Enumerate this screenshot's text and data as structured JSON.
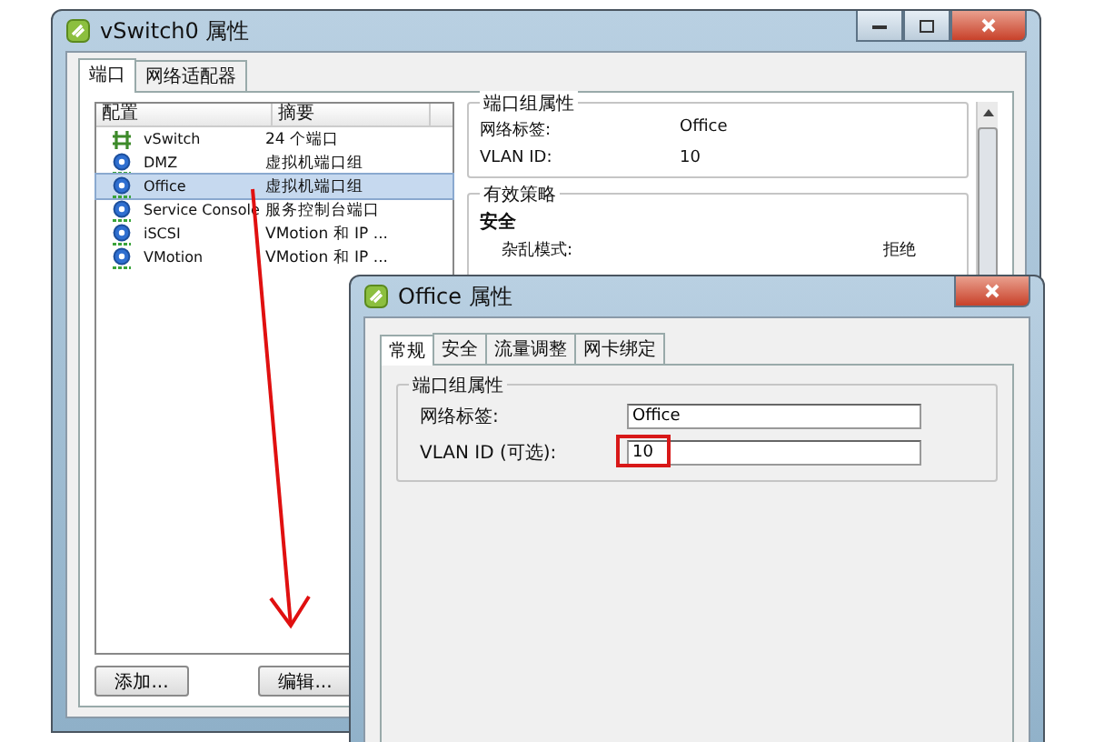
{
  "main_window": {
    "title": "vSwitch0 属性",
    "tabs": [
      {
        "label": "端口",
        "selected": true
      },
      {
        "label": "网络适配器",
        "selected": false
      }
    ],
    "list": {
      "columns": [
        "配置",
        "摘要"
      ],
      "rows": [
        {
          "kind": "switch",
          "name": "vSwitch",
          "summary": "24 个端口",
          "selected": false
        },
        {
          "kind": "port-group",
          "name": "DMZ",
          "summary": "虚拟机端口组",
          "selected": false
        },
        {
          "kind": "port-group",
          "name": "Office",
          "summary": "虚拟机端口组",
          "selected": true
        },
        {
          "kind": "port-group",
          "name": "Service Console",
          "summary": "服务控制台端口",
          "selected": false
        },
        {
          "kind": "port-group",
          "name": "iSCSI",
          "summary": "VMotion 和 IP ...",
          "selected": false
        },
        {
          "kind": "port-group",
          "name": "VMotion",
          "summary": "VMotion 和 IP ...",
          "selected": false
        }
      ]
    },
    "buttons": [
      "添加...",
      "编辑..."
    ],
    "port_group_properties": {
      "title": "端口组属性",
      "rows": [
        {
          "label": "网络标签:",
          "value": "Office"
        },
        {
          "label": "VLAN ID:",
          "value": "10"
        }
      ]
    },
    "effective_policy": {
      "title": "有效策略",
      "section": "安全",
      "rows": [
        {
          "label": "杂乱模式:",
          "value": "拒绝"
        }
      ]
    }
  },
  "dialog": {
    "title": "Office 属性",
    "tabs": [
      {
        "label": "常规",
        "selected": true
      },
      {
        "label": "安全",
        "selected": false
      },
      {
        "label": "流量调整",
        "selected": false
      },
      {
        "label": "网卡绑定",
        "selected": false
      }
    ],
    "group_title": "端口组属性",
    "fields": [
      {
        "label": "网络标签:",
        "value": "Office",
        "highlighted": false
      },
      {
        "label": "VLAN ID (可选):",
        "value": "10",
        "highlighted": true
      }
    ]
  }
}
